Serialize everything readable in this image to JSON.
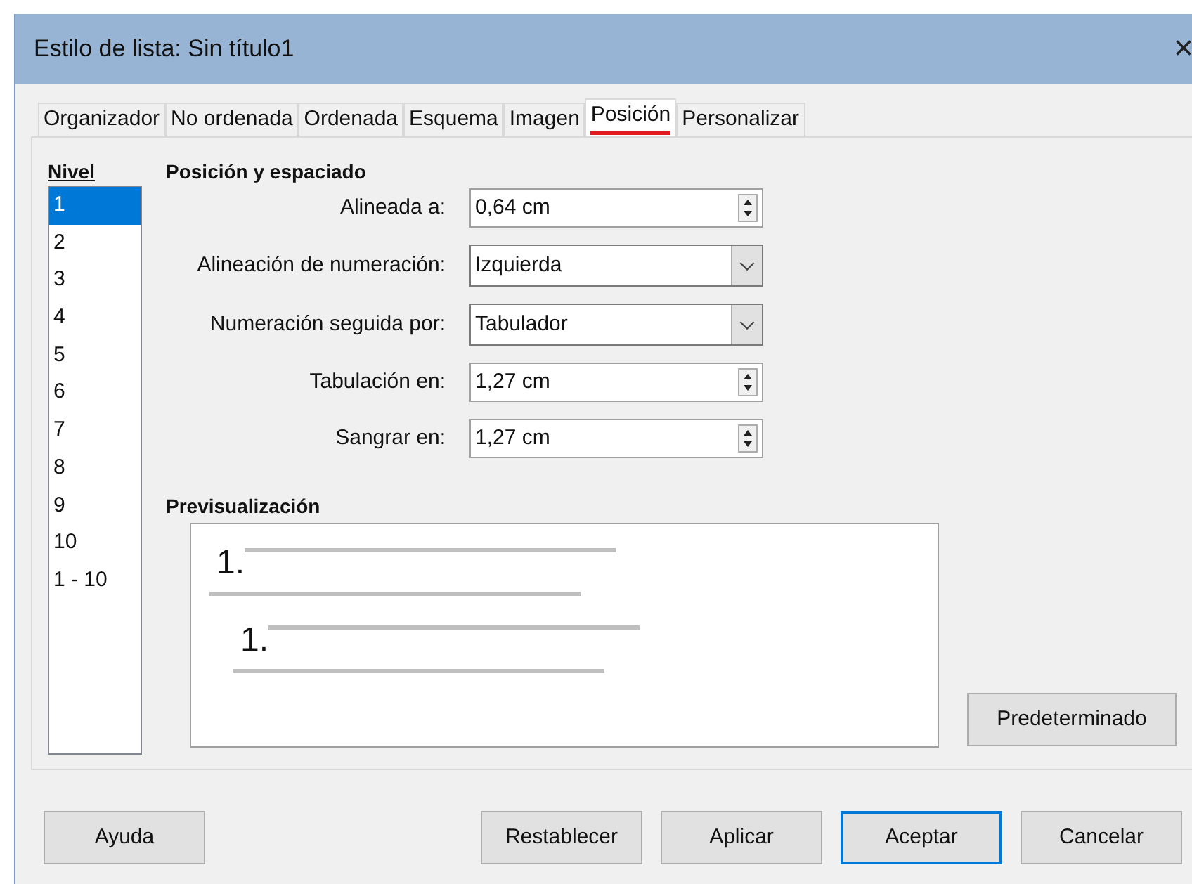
{
  "window": {
    "title": "Estilo de lista: Sin título1",
    "close": "×"
  },
  "tabs": [
    {
      "label": "Organizador",
      "selected": false
    },
    {
      "label": "No ordenada",
      "selected": false
    },
    {
      "label": "Ordenada",
      "selected": false
    },
    {
      "label": "Esquema",
      "selected": false
    },
    {
      "label": "Imagen",
      "selected": false
    },
    {
      "label": "Posición",
      "selected": true
    },
    {
      "label": "Personalizar",
      "selected": false
    }
  ],
  "levels": {
    "label": "Nivel",
    "items": [
      {
        "label": "1",
        "selected": true
      },
      {
        "label": "2",
        "selected": false
      },
      {
        "label": "3",
        "selected": false
      },
      {
        "label": "4",
        "selected": false
      },
      {
        "label": "5",
        "selected": false
      },
      {
        "label": "6",
        "selected": false
      },
      {
        "label": "7",
        "selected": false
      },
      {
        "label": "8",
        "selected": false
      },
      {
        "label": "9",
        "selected": false
      },
      {
        "label": "10",
        "selected": false
      },
      {
        "label": "1 - 10",
        "selected": false
      }
    ]
  },
  "position": {
    "heading": "Posición y espaciado",
    "fields": [
      {
        "label": "Alineada a:",
        "kind": "spin",
        "value": "0,64 cm"
      },
      {
        "label": "Alineación de numeración:",
        "kind": "dropdown",
        "value": "Izquierda"
      },
      {
        "label": "Numeración seguida por:",
        "kind": "dropdown",
        "value": "Tabulador"
      },
      {
        "label": "Tabulación en:",
        "kind": "spin",
        "value": "1,27 cm"
      },
      {
        "label": "Sangrar en:",
        "kind": "spin",
        "value": "1,27 cm"
      }
    ]
  },
  "preview": {
    "heading": "Previsualización",
    "items": [
      {
        "number": "1.",
        "children": [
          {
            "number": "1."
          }
        ]
      }
    ]
  },
  "default_button": "Predeterminado",
  "buttons": [
    {
      "label": "Ayuda",
      "default": false
    },
    {
      "label": "Restablecer",
      "default": false
    },
    {
      "label": "Aplicar",
      "default": false
    },
    {
      "label": "Aceptar",
      "default": true
    },
    {
      "label": "Cancelar",
      "default": false
    }
  ]
}
